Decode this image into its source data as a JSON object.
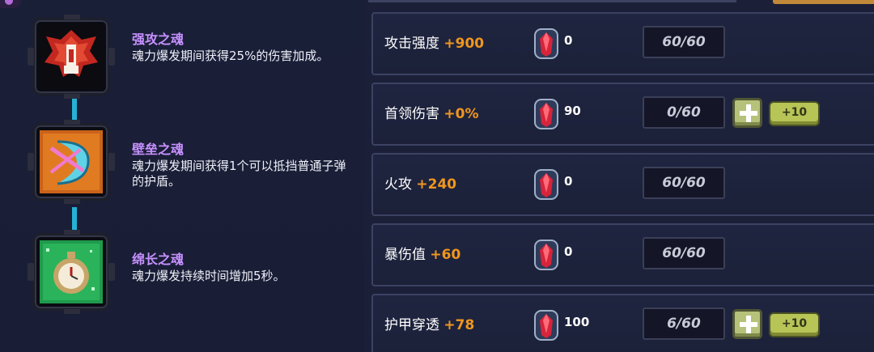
{
  "souls": [
    {
      "title": "强攻之魂",
      "desc": "魂力爆发期间获得25%的伤害加成。",
      "icon": "red-armor-icon"
    },
    {
      "title": "壁垒之魂",
      "desc": "魂力爆发期间获得1个可以抵挡普通子弹的护盾。",
      "icon": "shield-bow-icon"
    },
    {
      "title": "绵长之魂",
      "desc": "魂力爆发持续时间增加5秒。",
      "icon": "pocket-watch-icon"
    }
  ],
  "stats": [
    {
      "label": "攻击强度",
      "bonus": "+900",
      "gems": "0",
      "level": "60/60",
      "upgradable": false
    },
    {
      "label": "首领伤害",
      "bonus": "+0%",
      "gems": "90",
      "level": "0/60",
      "upgradable": true,
      "plus10_label": "+10"
    },
    {
      "label": "火攻",
      "bonus": "+240",
      "gems": "0",
      "level": "60/60",
      "upgradable": false
    },
    {
      "label": "暴伤值",
      "bonus": "+60",
      "gems": "0",
      "level": "60/60",
      "upgradable": false
    },
    {
      "label": "护甲穿透",
      "bonus": "+78",
      "gems": "100",
      "level": "6/60",
      "upgradable": true,
      "plus10_label": "+10"
    }
  ],
  "colors": {
    "soul_title": "#c791ff",
    "bonus": "#f0961e",
    "connector": "#25b2d6",
    "button": "#b6c27a"
  },
  "icons": {
    "gem": "red-gem-icon",
    "plus": "plus-icon"
  }
}
